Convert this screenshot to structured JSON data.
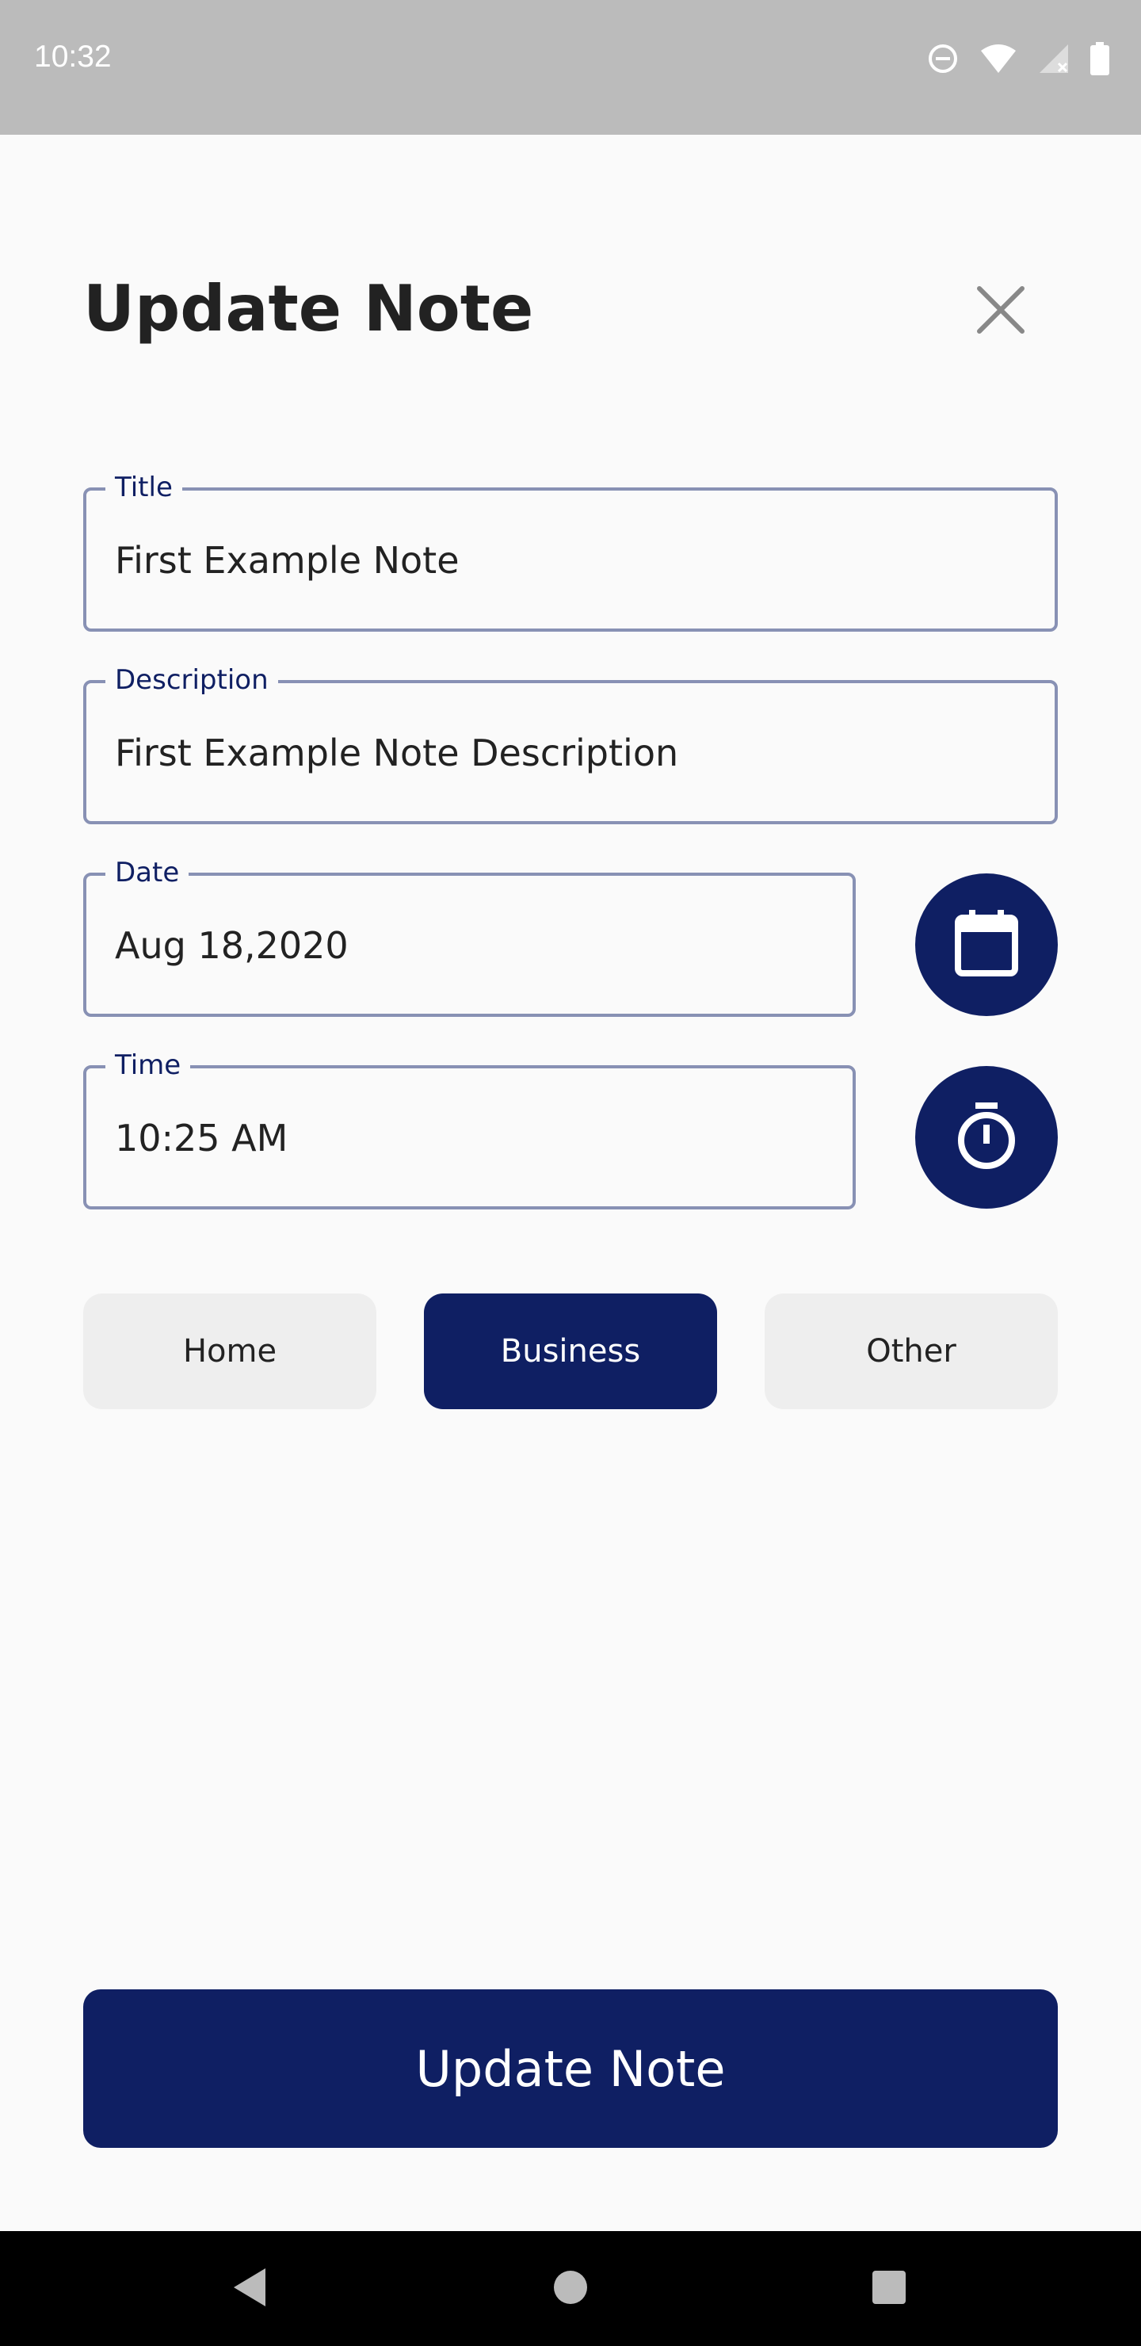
{
  "status_bar": {
    "time": "10:32",
    "icons": [
      "do-not-disturb-icon",
      "wifi-icon",
      "signal-no-sim-icon",
      "battery-icon"
    ],
    "background": "#bbbbbb"
  },
  "dialog": {
    "title": "Update Note",
    "close_icon": "close-icon"
  },
  "form": {
    "title": {
      "label": "Title",
      "value": "First Example Note"
    },
    "description": {
      "label": "Description",
      "value": "First Example Note Description"
    },
    "date": {
      "label": "Date",
      "value": "Aug 18,2020",
      "button_icon": "calendar-icon"
    },
    "time": {
      "label": "Time",
      "value": "10:25 AM",
      "button_icon": "timer-icon"
    }
  },
  "categories": {
    "options": [
      "Home",
      "Business",
      "Other"
    ],
    "selected": "Business"
  },
  "submit": {
    "label": "Update Note"
  },
  "nav_bar": {
    "icons": [
      "back-icon",
      "home-icon",
      "recents-icon"
    ]
  },
  "colors": {
    "primary": "#0f1f63",
    "field_border": "#8891b4",
    "chip_bg": "#eeeeee",
    "background": "#fafafa"
  }
}
